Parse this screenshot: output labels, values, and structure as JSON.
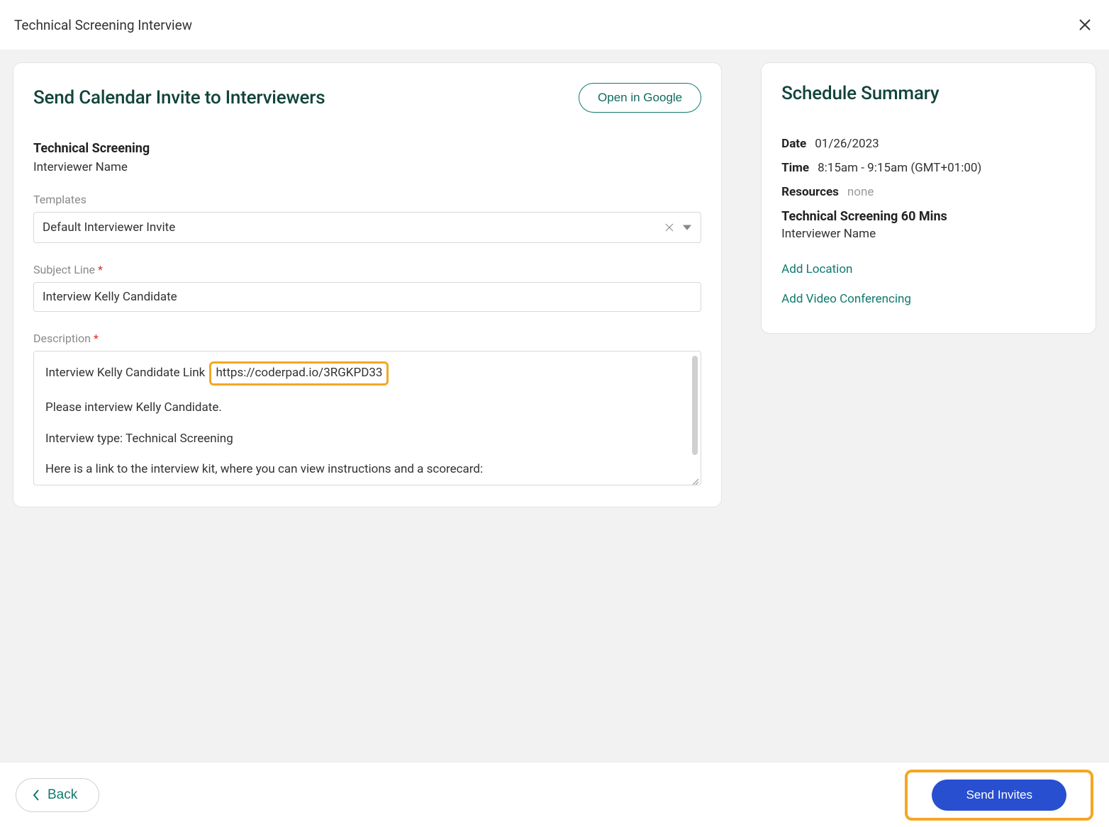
{
  "header": {
    "title": "Technical Screening Interview"
  },
  "main": {
    "panel_title": "Send Calendar Invite to Interviewers",
    "open_in_google": "Open in Google",
    "screening_title": "Technical Screening",
    "interviewer_name": "Interviewer Name",
    "templates_label": "Templates",
    "template_value": "Default Interviewer Invite",
    "subject_label": "Subject Line",
    "subject_value": "Interview Kelly Candidate",
    "description_label": "Description",
    "description": {
      "line1_prefix": "Interview Kelly Candidate Link",
      "line1_link": "https://coderpad.io/3RGKPD33",
      "line2": "Please interview Kelly Candidate.",
      "line3": "Interview type: Technical Screening",
      "line4": "Here is a link to the interview kit, where you can view instructions and a scorecard:"
    }
  },
  "summary": {
    "title": "Schedule Summary",
    "date_key": "Date",
    "date_val": "01/26/2023",
    "time_key": "Time",
    "time_val": "8:15am - 9:15am (GMT+01:00)",
    "resources_key": "Resources",
    "resources_val": "none",
    "screening_line": "Technical Screening 60 Mins",
    "interviewer_line": "Interviewer Name",
    "add_location": "Add Location",
    "add_video": "Add Video Conferencing"
  },
  "footer": {
    "back": "Back",
    "send": "Send Invites"
  }
}
